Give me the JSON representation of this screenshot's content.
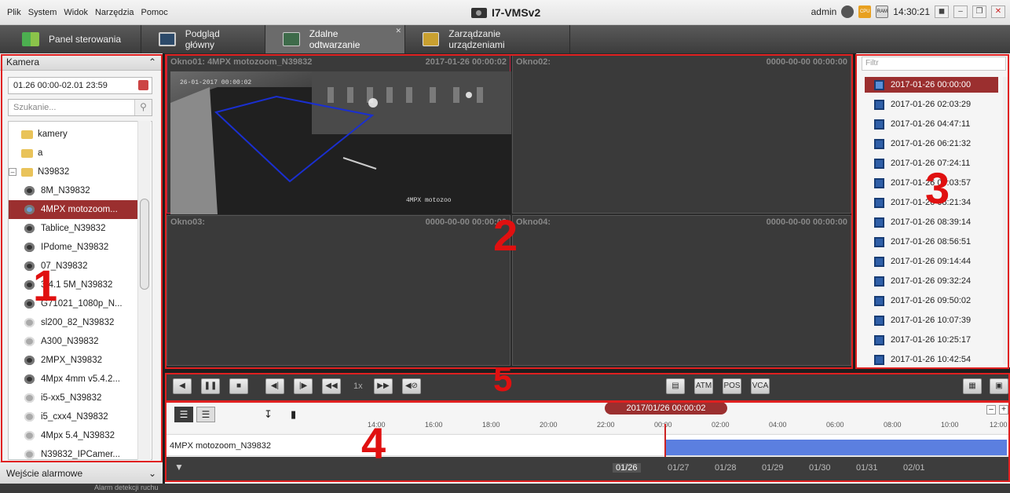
{
  "menu": {
    "items": [
      "Plik",
      "System",
      "Widok",
      "Narzędzia",
      "Pomoc"
    ]
  },
  "app": {
    "title": "I7-VMSv2",
    "user": "admin",
    "clock": "14:30:21",
    "cpu_label": "CPU",
    "ram_label": "RAM"
  },
  "tabs": [
    {
      "label": "Panel sterowania"
    },
    {
      "label": "Podgląd główny"
    },
    {
      "label": "Zdalne odtwarzanie"
    },
    {
      "label": "Zarządzanie urządzeniami"
    }
  ],
  "left": {
    "header": "Kamera",
    "date_range": "01.26 00:00-02.01 23:59",
    "search_placeholder": "Szukanie...",
    "tree": [
      "kamery",
      "a",
      "N39832",
      "8M_N39832",
      "4MPX motozoom...",
      "Tablice_N39832",
      "IPdome_N39832",
      "07_N39832",
      "3.4.1 5M_N39832",
      "G71021_1080p_N...",
      "sl200_82_N39832",
      "A300_N39832",
      "2MPX_N39832",
      "4Mpx 4mm v5.4.2...",
      "i5-xx5_N39832",
      "i5_cxx4_N39832",
      "4Mpx 5.4_N39832",
      "N39832_IPCamer..."
    ],
    "alarm_header": "Wejście alarmowe"
  },
  "windows": [
    {
      "title": "Okno01: 4MPX motozoom_N39832",
      "time": "2017-01-26 00:00:02"
    },
    {
      "title": "Okno02:",
      "time": "0000-00-00 00:00:00"
    },
    {
      "title": "Okno03:",
      "time": "0000-00-00 00:00:00"
    },
    {
      "title": "Okno04:",
      "time": "0000-00-00 00:00:00"
    }
  ],
  "video": {
    "osd_time": "26-01-2017 00:00:02",
    "osd_label": "4MPX motozoo"
  },
  "right": {
    "filter_placeholder": "Filtr",
    "records": [
      "2017-01-26 00:00:00",
      "2017-01-26 02:03:29",
      "2017-01-26 04:47:11",
      "2017-01-26 06:21:32",
      "2017-01-26 07:24:11",
      "2017-01-26 08:03:57",
      "2017-01-26 08:21:34",
      "2017-01-26 08:39:14",
      "2017-01-26 08:56:51",
      "2017-01-26 09:14:44",
      "2017-01-26 09:32:24",
      "2017-01-26 09:50:02",
      "2017-01-26 10:07:39",
      "2017-01-26 10:25:17",
      "2017-01-26 10:42:54"
    ]
  },
  "controls": {
    "speed": "1x"
  },
  "timeline": {
    "current": "2017/01/26 00:00:02",
    "hours": [
      "14:00",
      "16:00",
      "18:00",
      "20:00",
      "22:00",
      "00:00",
      "02:00",
      "04:00",
      "06:00",
      "08:00",
      "10:00",
      "12:00"
    ],
    "track": "4MPX motozoom_N39832",
    "days": [
      "01/26",
      "01/27",
      "01/28",
      "01/29",
      "01/30",
      "01/31",
      "02/01"
    ],
    "record_color": "#5b7fe0"
  },
  "status": {
    "text": "Alarm detekcji ruchu"
  },
  "annotations": [
    "1",
    "2",
    "3",
    "4",
    "5"
  ]
}
